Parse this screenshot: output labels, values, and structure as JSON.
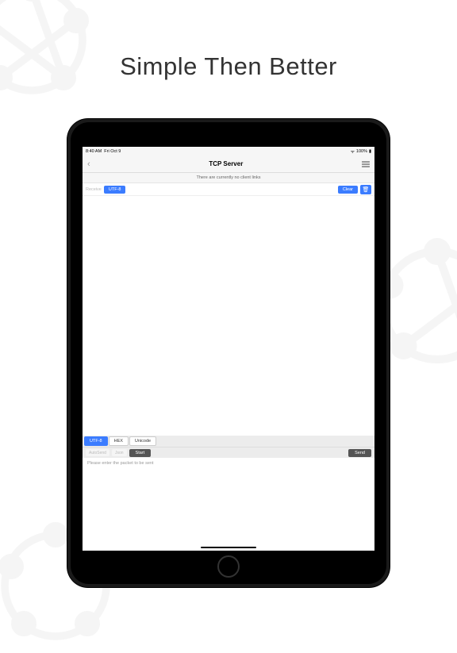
{
  "headline": "Simple Then Better",
  "status": {
    "time": "8:40 AM",
    "date": "Fri Oct 9",
    "battery": "100%"
  },
  "nav": {
    "title": "TCP Server"
  },
  "subbar": {
    "msg": "There are currently no client links"
  },
  "receive": {
    "label": "Receive",
    "encoding": "UTF-8",
    "clear": "Clear"
  },
  "encoding_tabs": {
    "utf8": "UTF-8",
    "hex": "HEX",
    "unicode": "Unicode"
  },
  "sendbar": {
    "auto": "AutoSend",
    "json": "Json",
    "start": "Start",
    "send": "Send"
  },
  "input": {
    "placeholder": "Please enter the packet to be sent"
  }
}
